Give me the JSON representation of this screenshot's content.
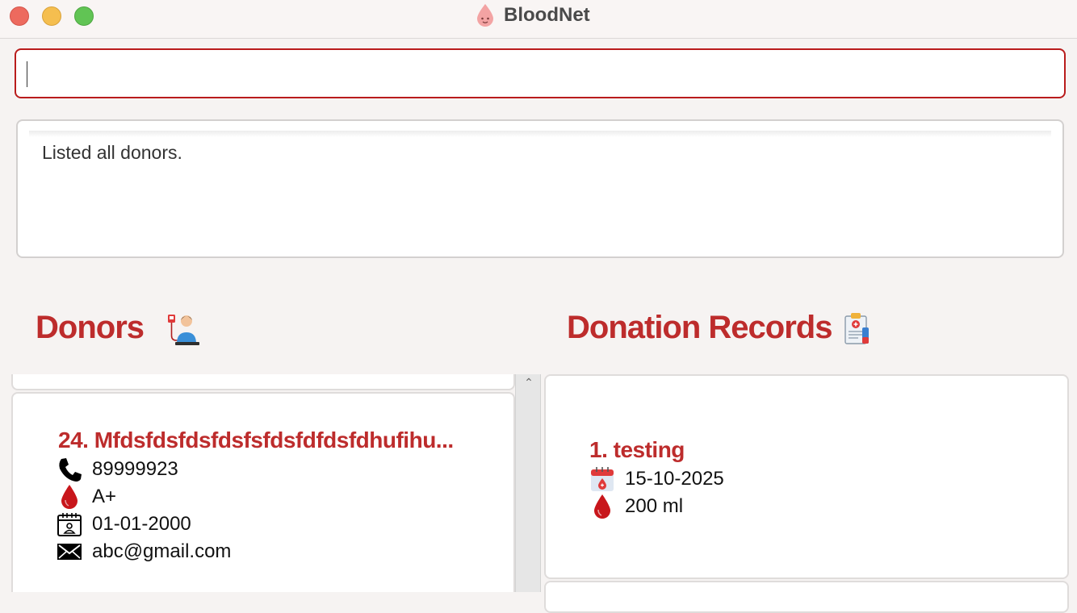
{
  "app": {
    "title": "BloodNet"
  },
  "command_box": {
    "value": ""
  },
  "result_display": {
    "message": "Listed all donors."
  },
  "donors_panel": {
    "heading": "Donors",
    "selected_donor": {
      "title": "24. Mfdsfdsfdsfdsfsfdsfdfdsfdhufihu...",
      "phone": "89999923",
      "blood_type": "A+",
      "date_of_birth": "01-01-2000",
      "email": "abc@gmail.com"
    }
  },
  "records_panel": {
    "heading": "Donation Records",
    "record": {
      "title": "1. testing",
      "date": "15-10-2025",
      "volume": "200 ml"
    }
  },
  "colors": {
    "accent": "#bd2c2c",
    "command_border": "#b91c1c"
  }
}
